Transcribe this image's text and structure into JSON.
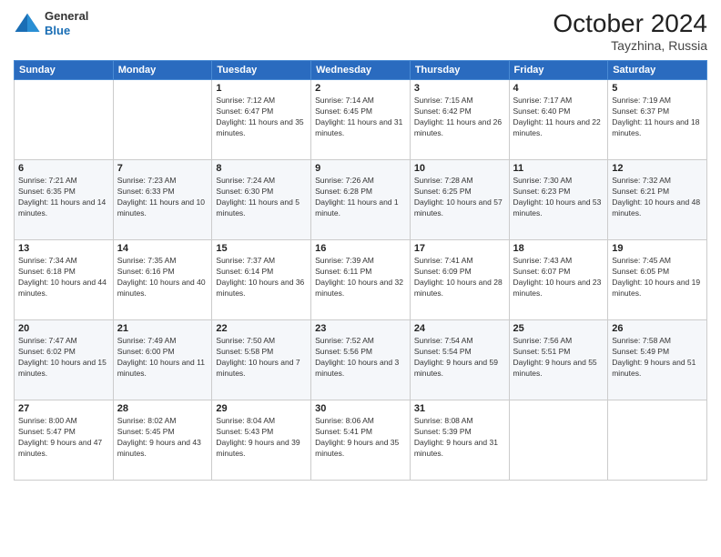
{
  "header": {
    "logo_general": "General",
    "logo_blue": "Blue",
    "month_title": "October 2024",
    "location": "Tayzhina, Russia"
  },
  "days_of_week": [
    "Sunday",
    "Monday",
    "Tuesday",
    "Wednesday",
    "Thursday",
    "Friday",
    "Saturday"
  ],
  "weeks": [
    [
      {
        "day": "",
        "sunrise": "",
        "sunset": "",
        "daylight": ""
      },
      {
        "day": "",
        "sunrise": "",
        "sunset": "",
        "daylight": ""
      },
      {
        "day": "1",
        "sunrise": "Sunrise: 7:12 AM",
        "sunset": "Sunset: 6:47 PM",
        "daylight": "Daylight: 11 hours and 35 minutes."
      },
      {
        "day": "2",
        "sunrise": "Sunrise: 7:14 AM",
        "sunset": "Sunset: 6:45 PM",
        "daylight": "Daylight: 11 hours and 31 minutes."
      },
      {
        "day": "3",
        "sunrise": "Sunrise: 7:15 AM",
        "sunset": "Sunset: 6:42 PM",
        "daylight": "Daylight: 11 hours and 26 minutes."
      },
      {
        "day": "4",
        "sunrise": "Sunrise: 7:17 AM",
        "sunset": "Sunset: 6:40 PM",
        "daylight": "Daylight: 11 hours and 22 minutes."
      },
      {
        "day": "5",
        "sunrise": "Sunrise: 7:19 AM",
        "sunset": "Sunset: 6:37 PM",
        "daylight": "Daylight: 11 hours and 18 minutes."
      }
    ],
    [
      {
        "day": "6",
        "sunrise": "Sunrise: 7:21 AM",
        "sunset": "Sunset: 6:35 PM",
        "daylight": "Daylight: 11 hours and 14 minutes."
      },
      {
        "day": "7",
        "sunrise": "Sunrise: 7:23 AM",
        "sunset": "Sunset: 6:33 PM",
        "daylight": "Daylight: 11 hours and 10 minutes."
      },
      {
        "day": "8",
        "sunrise": "Sunrise: 7:24 AM",
        "sunset": "Sunset: 6:30 PM",
        "daylight": "Daylight: 11 hours and 5 minutes."
      },
      {
        "day": "9",
        "sunrise": "Sunrise: 7:26 AM",
        "sunset": "Sunset: 6:28 PM",
        "daylight": "Daylight: 11 hours and 1 minute."
      },
      {
        "day": "10",
        "sunrise": "Sunrise: 7:28 AM",
        "sunset": "Sunset: 6:25 PM",
        "daylight": "Daylight: 10 hours and 57 minutes."
      },
      {
        "day": "11",
        "sunrise": "Sunrise: 7:30 AM",
        "sunset": "Sunset: 6:23 PM",
        "daylight": "Daylight: 10 hours and 53 minutes."
      },
      {
        "day": "12",
        "sunrise": "Sunrise: 7:32 AM",
        "sunset": "Sunset: 6:21 PM",
        "daylight": "Daylight: 10 hours and 48 minutes."
      }
    ],
    [
      {
        "day": "13",
        "sunrise": "Sunrise: 7:34 AM",
        "sunset": "Sunset: 6:18 PM",
        "daylight": "Daylight: 10 hours and 44 minutes."
      },
      {
        "day": "14",
        "sunrise": "Sunrise: 7:35 AM",
        "sunset": "Sunset: 6:16 PM",
        "daylight": "Daylight: 10 hours and 40 minutes."
      },
      {
        "day": "15",
        "sunrise": "Sunrise: 7:37 AM",
        "sunset": "Sunset: 6:14 PM",
        "daylight": "Daylight: 10 hours and 36 minutes."
      },
      {
        "day": "16",
        "sunrise": "Sunrise: 7:39 AM",
        "sunset": "Sunset: 6:11 PM",
        "daylight": "Daylight: 10 hours and 32 minutes."
      },
      {
        "day": "17",
        "sunrise": "Sunrise: 7:41 AM",
        "sunset": "Sunset: 6:09 PM",
        "daylight": "Daylight: 10 hours and 28 minutes."
      },
      {
        "day": "18",
        "sunrise": "Sunrise: 7:43 AM",
        "sunset": "Sunset: 6:07 PM",
        "daylight": "Daylight: 10 hours and 23 minutes."
      },
      {
        "day": "19",
        "sunrise": "Sunrise: 7:45 AM",
        "sunset": "Sunset: 6:05 PM",
        "daylight": "Daylight: 10 hours and 19 minutes."
      }
    ],
    [
      {
        "day": "20",
        "sunrise": "Sunrise: 7:47 AM",
        "sunset": "Sunset: 6:02 PM",
        "daylight": "Daylight: 10 hours and 15 minutes."
      },
      {
        "day": "21",
        "sunrise": "Sunrise: 7:49 AM",
        "sunset": "Sunset: 6:00 PM",
        "daylight": "Daylight: 10 hours and 11 minutes."
      },
      {
        "day": "22",
        "sunrise": "Sunrise: 7:50 AM",
        "sunset": "Sunset: 5:58 PM",
        "daylight": "Daylight: 10 hours and 7 minutes."
      },
      {
        "day": "23",
        "sunrise": "Sunrise: 7:52 AM",
        "sunset": "Sunset: 5:56 PM",
        "daylight": "Daylight: 10 hours and 3 minutes."
      },
      {
        "day": "24",
        "sunrise": "Sunrise: 7:54 AM",
        "sunset": "Sunset: 5:54 PM",
        "daylight": "Daylight: 9 hours and 59 minutes."
      },
      {
        "day": "25",
        "sunrise": "Sunrise: 7:56 AM",
        "sunset": "Sunset: 5:51 PM",
        "daylight": "Daylight: 9 hours and 55 minutes."
      },
      {
        "day": "26",
        "sunrise": "Sunrise: 7:58 AM",
        "sunset": "Sunset: 5:49 PM",
        "daylight": "Daylight: 9 hours and 51 minutes."
      }
    ],
    [
      {
        "day": "27",
        "sunrise": "Sunrise: 8:00 AM",
        "sunset": "Sunset: 5:47 PM",
        "daylight": "Daylight: 9 hours and 47 minutes."
      },
      {
        "day": "28",
        "sunrise": "Sunrise: 8:02 AM",
        "sunset": "Sunset: 5:45 PM",
        "daylight": "Daylight: 9 hours and 43 minutes."
      },
      {
        "day": "29",
        "sunrise": "Sunrise: 8:04 AM",
        "sunset": "Sunset: 5:43 PM",
        "daylight": "Daylight: 9 hours and 39 minutes."
      },
      {
        "day": "30",
        "sunrise": "Sunrise: 8:06 AM",
        "sunset": "Sunset: 5:41 PM",
        "daylight": "Daylight: 9 hours and 35 minutes."
      },
      {
        "day": "31",
        "sunrise": "Sunrise: 8:08 AM",
        "sunset": "Sunset: 5:39 PM",
        "daylight": "Daylight: 9 hours and 31 minutes."
      },
      {
        "day": "",
        "sunrise": "",
        "sunset": "",
        "daylight": ""
      },
      {
        "day": "",
        "sunrise": "",
        "sunset": "",
        "daylight": ""
      }
    ]
  ]
}
